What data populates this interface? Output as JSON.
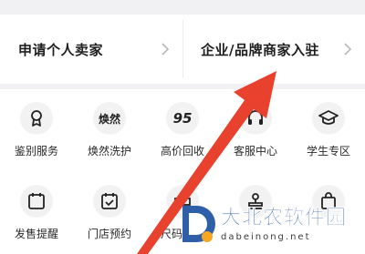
{
  "entries": [
    {
      "label": "申请个人卖家"
    },
    {
      "label": "企业/品牌商家入驻"
    }
  ],
  "services_row1": [
    {
      "label": "鉴别服务",
      "icon": "certificate-icon"
    },
    {
      "label": "焕然洗护",
      "icon": "huanran-logo-icon",
      "icon_text": "焕然"
    },
    {
      "label": "高价回收",
      "icon": "recycle-95-icon",
      "icon_text": "95"
    },
    {
      "label": "客服中心",
      "icon": "headset-icon"
    },
    {
      "label": "学生专区",
      "icon": "graduation-cap-icon"
    }
  ],
  "services_row2": [
    {
      "label": "发售提醒",
      "icon": "calendar-10-icon",
      "icon_text": "10"
    },
    {
      "label": "门店预约",
      "icon": "calendar-check-icon"
    },
    {
      "label": "尺码管理",
      "icon": "ruler-icon"
    },
    {
      "label": "",
      "icon": "stamp-icon"
    },
    {
      "label": "",
      "icon": "bag-icon"
    }
  ],
  "watermark": {
    "title": "大北农软件园",
    "url": "dabeinong.net"
  },
  "colors": {
    "annotation_arrow": "#e8422f",
    "watermark_blue": "#2f5fa8"
  }
}
